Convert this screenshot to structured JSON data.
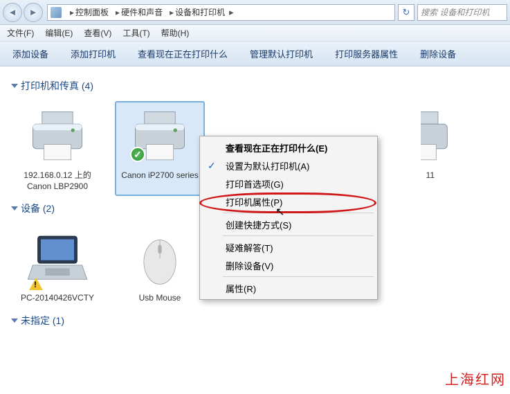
{
  "nav": {
    "breadcrumbs": [
      "控制面板",
      "硬件和声音",
      "设备和打印机"
    ],
    "search_placeholder": "搜索 设备和打印机"
  },
  "menu": {
    "items": [
      "文件(F)",
      "编辑(E)",
      "查看(V)",
      "工具(T)",
      "帮助(H)"
    ]
  },
  "toolbar": {
    "items": [
      "添加设备",
      "添加打印机",
      "查看现在正在打印什么",
      "管理默认打印机",
      "打印服务器属性",
      "删除设备"
    ]
  },
  "sections": {
    "printers": {
      "title": "打印机和传真 (4)"
    },
    "devices": {
      "title": "设备 (2)"
    },
    "unspecified": {
      "title": "未指定 (1)"
    }
  },
  "printers": {
    "p1": {
      "label": "192.168.0.12 上的 Canon LBP2900"
    },
    "p2": {
      "label": "Canon iP2700 series"
    },
    "p3_partial": {
      "label": "11"
    }
  },
  "devices": {
    "d1": {
      "label": "PC-20140426VCTY"
    },
    "d2": {
      "label": "Usb Mouse"
    }
  },
  "context_menu": {
    "items": [
      {
        "label": "查看现在正在打印什么(E)",
        "bold": true
      },
      {
        "label": "设置为默认打印机(A)",
        "checked": true
      },
      {
        "label": "打印首选项(G)"
      },
      {
        "label": "打印机属性(P)",
        "highlighted": true
      },
      {
        "sep": true
      },
      {
        "label": "创建快捷方式(S)"
      },
      {
        "sep": true
      },
      {
        "label": "疑难解答(T)"
      },
      {
        "label": "删除设备(V)"
      },
      {
        "sep": true
      },
      {
        "label": "属性(R)"
      }
    ]
  },
  "watermark": "上海红网"
}
